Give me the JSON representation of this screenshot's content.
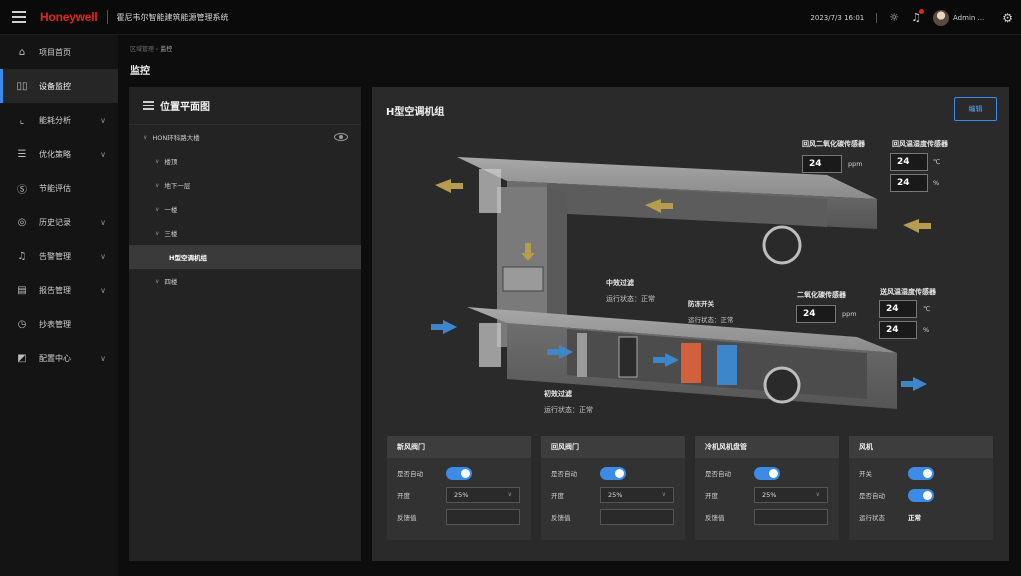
{
  "header": {
    "brand": "Honeywell",
    "system_title": "霍尼韦尔智能建筑能源管理系统",
    "datetime": "2023/7/3  16:01",
    "user": "Admin ..."
  },
  "sidebar": {
    "items": [
      {
        "label": "项目首页",
        "icon": "home-icon",
        "chevron": false
      },
      {
        "label": "设备监控",
        "icon": "device-monitor-icon",
        "chevron": false,
        "active": true
      },
      {
        "label": "能耗分析",
        "icon": "chart-icon",
        "chevron": true
      },
      {
        "label": "优化策略",
        "icon": "strategy-icon",
        "chevron": true
      },
      {
        "label": "节能评估",
        "icon": "dollar-icon",
        "chevron": false
      },
      {
        "label": "历史记录",
        "icon": "history-icon",
        "chevron": true
      },
      {
        "label": "告警管理",
        "icon": "bell-icon",
        "chevron": true
      },
      {
        "label": "报告管理",
        "icon": "document-icon",
        "chevron": true
      },
      {
        "label": "抄表管理",
        "icon": "meter-icon",
        "chevron": false
      },
      {
        "label": "配置中心",
        "icon": "config-icon",
        "chevron": true
      }
    ]
  },
  "breadcrumb": {
    "parent": "区域管理",
    "separator": " › ",
    "current": "监控"
  },
  "page_title": "监控",
  "location_panel": {
    "title": "位置平面图",
    "tree": [
      {
        "label": "HON环科路大楼",
        "level": 0
      },
      {
        "label": "楼顶",
        "level": 1
      },
      {
        "label": "地下一层",
        "level": 1
      },
      {
        "label": "一楼",
        "level": 1
      },
      {
        "label": "三楼",
        "level": 1,
        "expanded": true
      },
      {
        "label": "H型空调机组",
        "level": 2,
        "selected": true
      },
      {
        "label": "四楼",
        "level": 1
      }
    ]
  },
  "unit_panel": {
    "title": "H型空调机组",
    "edit_label": "编辑",
    "annotations": {
      "return_co2": {
        "title": "回风二氧化碳传感器",
        "value": "24",
        "unit": "ppm"
      },
      "return_temp_hum": {
        "title": "回风温湿度传感器",
        "temp": "24",
        "temp_unit": "℃",
        "hum": "24",
        "hum_unit": "%"
      },
      "medium_filter": {
        "title": "中效过滤",
        "status_label": "运行状态：",
        "status": "正常"
      },
      "antifreeze": {
        "title": "防冻开关",
        "status_label": "运行状态：",
        "status": "正常"
      },
      "supply_co2": {
        "title": "二氧化碳传感器",
        "value": "24",
        "unit": "ppm"
      },
      "supply_temp_hum": {
        "title": "送风温湿度传感器",
        "temp": "24",
        "temp_unit": "℃",
        "hum": "24",
        "hum_unit": "%"
      },
      "primary_filter": {
        "title": "初效过滤",
        "status_label": "运行状态：",
        "status": "正常"
      }
    },
    "cards": [
      {
        "title": "新风阀门",
        "auto_label": "是否自动",
        "open_label": "开度",
        "open_value": "25%",
        "feedback_label": "反馈值"
      },
      {
        "title": "回风阀门",
        "auto_label": "是否自动",
        "open_label": "开度",
        "open_value": "25%",
        "feedback_label": "反馈值"
      },
      {
        "title": "冷机风机盘管",
        "auto_label": "是否自动",
        "open_label": "开度",
        "open_value": "25%",
        "feedback_label": "反馈值"
      },
      {
        "title": "风机",
        "switch_label": "开关",
        "auto_label": "是否自动",
        "status_label": "运行状态",
        "status_value": "正常"
      }
    ]
  },
  "colors": {
    "accent": "#3c8ce7",
    "brand": "#e0251f",
    "background": "#0d0d0d",
    "panel": "#2a2a2a"
  }
}
